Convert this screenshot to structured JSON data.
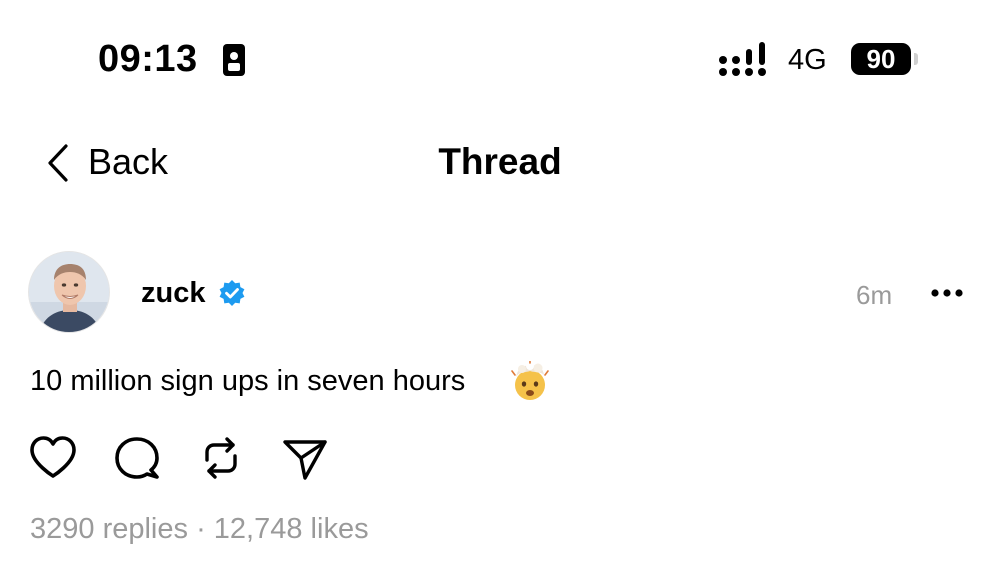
{
  "status_bar": {
    "time": "09:13",
    "network": "4G",
    "battery": "90"
  },
  "nav": {
    "back_label": "Back",
    "title": "Thread"
  },
  "post": {
    "username": "zuck",
    "verified": true,
    "time_ago": "6m",
    "text": "10 million sign ups in seven hours",
    "emoji": "exploding-head-icon",
    "replies": "3290 replies",
    "separator": "·",
    "likes": "12,748 likes"
  },
  "actions": [
    "like",
    "comment",
    "repost",
    "share"
  ],
  "colors": {
    "verified_blue": "#1d9bf0",
    "muted_text": "#9a9a9a"
  }
}
